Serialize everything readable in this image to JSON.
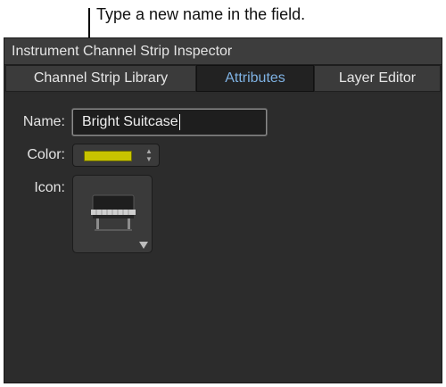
{
  "callout": {
    "text": "Type a new name in the field."
  },
  "window": {
    "title": "Instrument Channel Strip Inspector"
  },
  "tabs": [
    {
      "label": "Channel Strip Library",
      "selected": false
    },
    {
      "label": "Attributes",
      "selected": true
    },
    {
      "label": "Layer Editor",
      "selected": false
    }
  ],
  "attributes": {
    "name_label": "Name:",
    "name_value": "Bright Suitcase",
    "color_label": "Color:",
    "color_value": "#c8c400",
    "icon_label": "Icon:",
    "icon_name": "electric-piano-icon"
  }
}
